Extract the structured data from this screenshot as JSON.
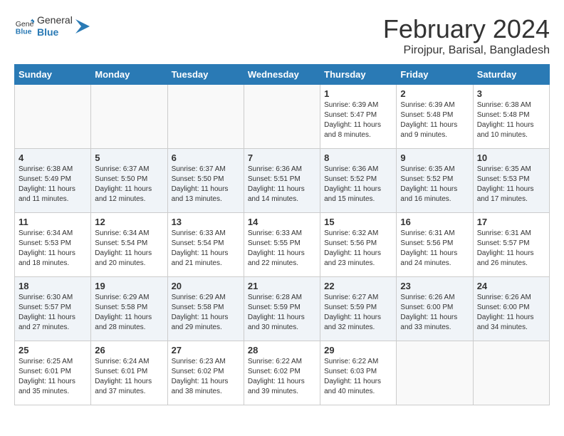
{
  "header": {
    "logo_general": "General",
    "logo_blue": "Blue",
    "month_year": "February 2024",
    "location": "Pirojpur, Barisal, Bangladesh"
  },
  "days_of_week": [
    "Sunday",
    "Monday",
    "Tuesday",
    "Wednesday",
    "Thursday",
    "Friday",
    "Saturday"
  ],
  "weeks": [
    [
      {
        "day": "",
        "info": ""
      },
      {
        "day": "",
        "info": ""
      },
      {
        "day": "",
        "info": ""
      },
      {
        "day": "",
        "info": ""
      },
      {
        "day": "1",
        "info": "Sunrise: 6:39 AM\nSunset: 5:47 PM\nDaylight: 11 hours\nand 8 minutes."
      },
      {
        "day": "2",
        "info": "Sunrise: 6:39 AM\nSunset: 5:48 PM\nDaylight: 11 hours\nand 9 minutes."
      },
      {
        "day": "3",
        "info": "Sunrise: 6:38 AM\nSunset: 5:48 PM\nDaylight: 11 hours\nand 10 minutes."
      }
    ],
    [
      {
        "day": "4",
        "info": "Sunrise: 6:38 AM\nSunset: 5:49 PM\nDaylight: 11 hours\nand 11 minutes."
      },
      {
        "day": "5",
        "info": "Sunrise: 6:37 AM\nSunset: 5:50 PM\nDaylight: 11 hours\nand 12 minutes."
      },
      {
        "day": "6",
        "info": "Sunrise: 6:37 AM\nSunset: 5:50 PM\nDaylight: 11 hours\nand 13 minutes."
      },
      {
        "day": "7",
        "info": "Sunrise: 6:36 AM\nSunset: 5:51 PM\nDaylight: 11 hours\nand 14 minutes."
      },
      {
        "day": "8",
        "info": "Sunrise: 6:36 AM\nSunset: 5:52 PM\nDaylight: 11 hours\nand 15 minutes."
      },
      {
        "day": "9",
        "info": "Sunrise: 6:35 AM\nSunset: 5:52 PM\nDaylight: 11 hours\nand 16 minutes."
      },
      {
        "day": "10",
        "info": "Sunrise: 6:35 AM\nSunset: 5:53 PM\nDaylight: 11 hours\nand 17 minutes."
      }
    ],
    [
      {
        "day": "11",
        "info": "Sunrise: 6:34 AM\nSunset: 5:53 PM\nDaylight: 11 hours\nand 18 minutes."
      },
      {
        "day": "12",
        "info": "Sunrise: 6:34 AM\nSunset: 5:54 PM\nDaylight: 11 hours\nand 20 minutes."
      },
      {
        "day": "13",
        "info": "Sunrise: 6:33 AM\nSunset: 5:54 PM\nDaylight: 11 hours\nand 21 minutes."
      },
      {
        "day": "14",
        "info": "Sunrise: 6:33 AM\nSunset: 5:55 PM\nDaylight: 11 hours\nand 22 minutes."
      },
      {
        "day": "15",
        "info": "Sunrise: 6:32 AM\nSunset: 5:56 PM\nDaylight: 11 hours\nand 23 minutes."
      },
      {
        "day": "16",
        "info": "Sunrise: 6:31 AM\nSunset: 5:56 PM\nDaylight: 11 hours\nand 24 minutes."
      },
      {
        "day": "17",
        "info": "Sunrise: 6:31 AM\nSunset: 5:57 PM\nDaylight: 11 hours\nand 26 minutes."
      }
    ],
    [
      {
        "day": "18",
        "info": "Sunrise: 6:30 AM\nSunset: 5:57 PM\nDaylight: 11 hours\nand 27 minutes."
      },
      {
        "day": "19",
        "info": "Sunrise: 6:29 AM\nSunset: 5:58 PM\nDaylight: 11 hours\nand 28 minutes."
      },
      {
        "day": "20",
        "info": "Sunrise: 6:29 AM\nSunset: 5:58 PM\nDaylight: 11 hours\nand 29 minutes."
      },
      {
        "day": "21",
        "info": "Sunrise: 6:28 AM\nSunset: 5:59 PM\nDaylight: 11 hours\nand 30 minutes."
      },
      {
        "day": "22",
        "info": "Sunrise: 6:27 AM\nSunset: 5:59 PM\nDaylight: 11 hours\nand 32 minutes."
      },
      {
        "day": "23",
        "info": "Sunrise: 6:26 AM\nSunset: 6:00 PM\nDaylight: 11 hours\nand 33 minutes."
      },
      {
        "day": "24",
        "info": "Sunrise: 6:26 AM\nSunset: 6:00 PM\nDaylight: 11 hours\nand 34 minutes."
      }
    ],
    [
      {
        "day": "25",
        "info": "Sunrise: 6:25 AM\nSunset: 6:01 PM\nDaylight: 11 hours\nand 35 minutes."
      },
      {
        "day": "26",
        "info": "Sunrise: 6:24 AM\nSunset: 6:01 PM\nDaylight: 11 hours\nand 37 minutes."
      },
      {
        "day": "27",
        "info": "Sunrise: 6:23 AM\nSunset: 6:02 PM\nDaylight: 11 hours\nand 38 minutes."
      },
      {
        "day": "28",
        "info": "Sunrise: 6:22 AM\nSunset: 6:02 PM\nDaylight: 11 hours\nand 39 minutes."
      },
      {
        "day": "29",
        "info": "Sunrise: 6:22 AM\nSunset: 6:03 PM\nDaylight: 11 hours\nand 40 minutes."
      },
      {
        "day": "",
        "info": ""
      },
      {
        "day": "",
        "info": ""
      }
    ]
  ]
}
